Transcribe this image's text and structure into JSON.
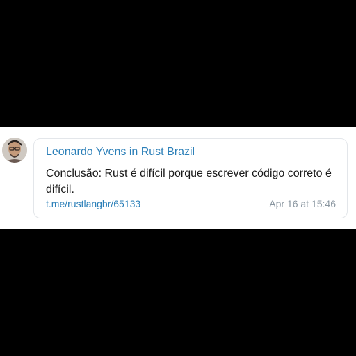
{
  "message": {
    "author": "Leonardo Yvens",
    "in_word": "in",
    "chat": "Rust Brazil",
    "text": "Conclusão: Rust é difícil porque escrever código correto é difícil.",
    "link": "t.me/rustlangbr/65133",
    "timestamp": "Apr 16 at 15:46"
  },
  "colors": {
    "accent": "#2b7fb8",
    "timestamp": "#8a96a0",
    "background": "#000000",
    "card": "#ffffff"
  },
  "icons": {
    "avatar": "user-avatar-photo"
  }
}
